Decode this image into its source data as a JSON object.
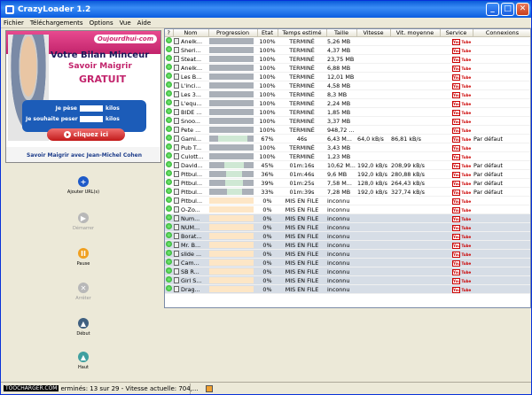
{
  "window": {
    "title": "CrazyLoader 1.2"
  },
  "menu": [
    "Fichier",
    "Téléchargements",
    "Options",
    "Vue",
    "Aide"
  ],
  "ad": {
    "logo": "Oujourdhui-com",
    "title": "Votre Bilan Minceur",
    "sub1": "Savoir Maigrir",
    "sub2": "GRATUIT",
    "field1_label": "Je pèse",
    "field1_unit": "kilos",
    "field2_label": "Je souhaite peser",
    "field2_unit": "kilos",
    "cta": "cliquez ici",
    "footer": "Savoir Maigrir avec Jean-Michel Cohen"
  },
  "tools": [
    {
      "label": "Ajouter URL(s)",
      "icon": "add-icon",
      "color": "#1e5ac8",
      "symbol": "+",
      "enabled": true
    },
    {
      "label": "Démarrer",
      "icon": "play-icon",
      "color": "#b8b8b8",
      "symbol": "▶",
      "enabled": false
    },
    {
      "label": "Pause",
      "icon": "pause-icon",
      "color": "#f0a020",
      "symbol": "II",
      "enabled": true
    },
    {
      "label": "Arrêter",
      "icon": "stop-icon",
      "color": "#b8b8b8",
      "symbol": "✕",
      "enabled": false
    },
    {
      "label": "Début",
      "icon": "move-top-icon",
      "color": "#406080",
      "symbol": "▲",
      "enabled": true
    },
    {
      "label": "Haut",
      "icon": "move-up-icon",
      "color": "#40a0a0",
      "symbol": "▲",
      "enabled": true
    }
  ],
  "columns": [
    "?",
    "Nom",
    "Progression",
    "Etat",
    "Temps estimé",
    "Taille",
    "Vitesse",
    "Vit. moyenne",
    "Service",
    "Connexions"
  ],
  "service_label": "You Tube",
  "rows": [
    {
      "name": "Anelk...",
      "progress": 100,
      "etat": "100%",
      "temps": "TERMINÉ",
      "taille": "5,26 MB",
      "vitesse": "",
      "moy": "",
      "conn": "",
      "queued": false
    },
    {
      "name": "Sheri...",
      "progress": 100,
      "etat": "100%",
      "temps": "TERMINÉ",
      "taille": "4,37 MB",
      "vitesse": "",
      "moy": "",
      "conn": "",
      "queued": false
    },
    {
      "name": "Steat...",
      "progress": 100,
      "etat": "100%",
      "temps": "TERMINÉ",
      "taille": "23,75 MB",
      "vitesse": "",
      "moy": "",
      "conn": "",
      "queued": false
    },
    {
      "name": "Anelk...",
      "progress": 100,
      "etat": "100%",
      "temps": "TERMINÉ",
      "taille": "6,88 MB",
      "vitesse": "",
      "moy": "",
      "conn": "",
      "queued": false
    },
    {
      "name": "Les B...",
      "progress": 100,
      "etat": "100%",
      "temps": "TERMINÉ",
      "taille": "12,01 MB",
      "vitesse": "",
      "moy": "",
      "conn": "",
      "queued": false
    },
    {
      "name": "L'inci...",
      "progress": 100,
      "etat": "100%",
      "temps": "TERMINÉ",
      "taille": "4,58 MB",
      "vitesse": "",
      "moy": "",
      "conn": "",
      "queued": false
    },
    {
      "name": "Les 3...",
      "progress": 100,
      "etat": "100%",
      "temps": "TERMINÉ",
      "taille": "8,3 MB",
      "vitesse": "",
      "moy": "",
      "conn": "",
      "queued": false
    },
    {
      "name": "L'equ...",
      "progress": 100,
      "etat": "100%",
      "temps": "TERMINÉ",
      "taille": "2,24 MB",
      "vitesse": "",
      "moy": "",
      "conn": "",
      "queued": false
    },
    {
      "name": "BIDE ...",
      "progress": 100,
      "etat": "100%",
      "temps": "TERMINÉ",
      "taille": "1,85 MB",
      "vitesse": "",
      "moy": "",
      "conn": "",
      "queued": false
    },
    {
      "name": "Snoo...",
      "progress": 100,
      "etat": "100%",
      "temps": "TERMINÉ",
      "taille": "3,37 MB",
      "vitesse": "",
      "moy": "",
      "conn": "",
      "queued": false
    },
    {
      "name": "Pete ...",
      "progress": 100,
      "etat": "100%",
      "temps": "TERMINÉ",
      "taille": "948,72 ...",
      "vitesse": "",
      "moy": "",
      "conn": "",
      "queued": false
    },
    {
      "name": "Gami...",
      "progress": 67,
      "etat": "67%",
      "temps": "46s",
      "taille": "6,43 M...",
      "vitesse": "64,0 kB/s",
      "moy": "86,81 kB/s",
      "conn": "Par défaut",
      "queued": false
    },
    {
      "name": "Pub T...",
      "progress": 100,
      "etat": "100%",
      "temps": "TERMINÉ",
      "taille": "3,43 MB",
      "vitesse": "",
      "moy": "",
      "conn": "",
      "queued": false
    },
    {
      "name": "Culott...",
      "progress": 100,
      "etat": "100%",
      "temps": "TERMINÉ",
      "taille": "1,23 MB",
      "vitesse": "",
      "moy": "",
      "conn": "",
      "queued": false
    },
    {
      "name": "David...",
      "progress": 45,
      "etat": "45%",
      "temps": "01m:16s",
      "taille": "10,62 M...",
      "vitesse": "192,0 kB/s",
      "moy": "208,99 kB/s",
      "conn": "Par défaut",
      "queued": false
    },
    {
      "name": "Pitbul...",
      "progress": 36,
      "etat": "36%",
      "temps": "01m:46s",
      "taille": "9,6 MB",
      "vitesse": "192,0 kB/s",
      "moy": "280,88 kB/s",
      "conn": "Par défaut",
      "queued": false
    },
    {
      "name": "Pitbul...",
      "progress": 39,
      "etat": "39%",
      "temps": "01m:25s",
      "taille": "7,58 M...",
      "vitesse": "128,0 kB/s",
      "moy": "264,43 kB/s",
      "conn": "Par défaut",
      "queued": false
    },
    {
      "name": "Pitbul...",
      "progress": 33,
      "etat": "33%",
      "temps": "01m:39s",
      "taille": "7,28 MB",
      "vitesse": "192,0 kB/s",
      "moy": "327,74 kB/s",
      "conn": "Par défaut",
      "queued": false
    },
    {
      "name": "Pitbul...",
      "progress": 0,
      "etat": "0%",
      "temps": "MIS EN FILE",
      "taille": "inconnu",
      "vitesse": "",
      "moy": "",
      "conn": "",
      "queued": false
    },
    {
      "name": "O-Zo...",
      "progress": 0,
      "etat": "0%",
      "temps": "MIS EN FILE",
      "taille": "inconnu",
      "vitesse": "",
      "moy": "",
      "conn": "",
      "queued": false
    },
    {
      "name": "Num...",
      "progress": 0,
      "etat": "0%",
      "temps": "MIS EN FILE",
      "taille": "inconnu",
      "vitesse": "",
      "moy": "",
      "conn": "",
      "queued": true
    },
    {
      "name": "NUM...",
      "progress": 0,
      "etat": "0%",
      "temps": "MIS EN FILE",
      "taille": "inconnu",
      "vitesse": "",
      "moy": "",
      "conn": "",
      "queued": true
    },
    {
      "name": "Borat...",
      "progress": 0,
      "etat": "0%",
      "temps": "MIS EN FILE",
      "taille": "inconnu",
      "vitesse": "",
      "moy": "",
      "conn": "",
      "queued": true
    },
    {
      "name": "Mr. B...",
      "progress": 0,
      "etat": "0%",
      "temps": "MIS EN FILE",
      "taille": "inconnu",
      "vitesse": "",
      "moy": "",
      "conn": "",
      "queued": true
    },
    {
      "name": "slide ...",
      "progress": 0,
      "etat": "0%",
      "temps": "MIS EN FILE",
      "taille": "inconnu",
      "vitesse": "",
      "moy": "",
      "conn": "",
      "queued": true
    },
    {
      "name": "Cam...",
      "progress": 0,
      "etat": "0%",
      "temps": "MIS EN FILE",
      "taille": "inconnu",
      "vitesse": "",
      "moy": "",
      "conn": "",
      "queued": true
    },
    {
      "name": "SB R...",
      "progress": 0,
      "etat": "0%",
      "temps": "MIS EN FILE",
      "taille": "inconnu",
      "vitesse": "",
      "moy": "",
      "conn": "",
      "queued": true
    },
    {
      "name": "Girl S...",
      "progress": 0,
      "etat": "0%",
      "temps": "MIS EN FILE",
      "taille": "inconnu",
      "vitesse": "",
      "moy": "",
      "conn": "",
      "queued": true
    },
    {
      "name": "Drag...",
      "progress": 0,
      "etat": "0%",
      "temps": "MIS EN FILE",
      "taille": "inconnu",
      "vitesse": "",
      "moy": "",
      "conn": "",
      "queued": true
    }
  ],
  "status": {
    "watermark": "TOOCHARGER.COM",
    "text": "erminés: 13 sur 29 - Vitesse actuelle: 704,..."
  }
}
